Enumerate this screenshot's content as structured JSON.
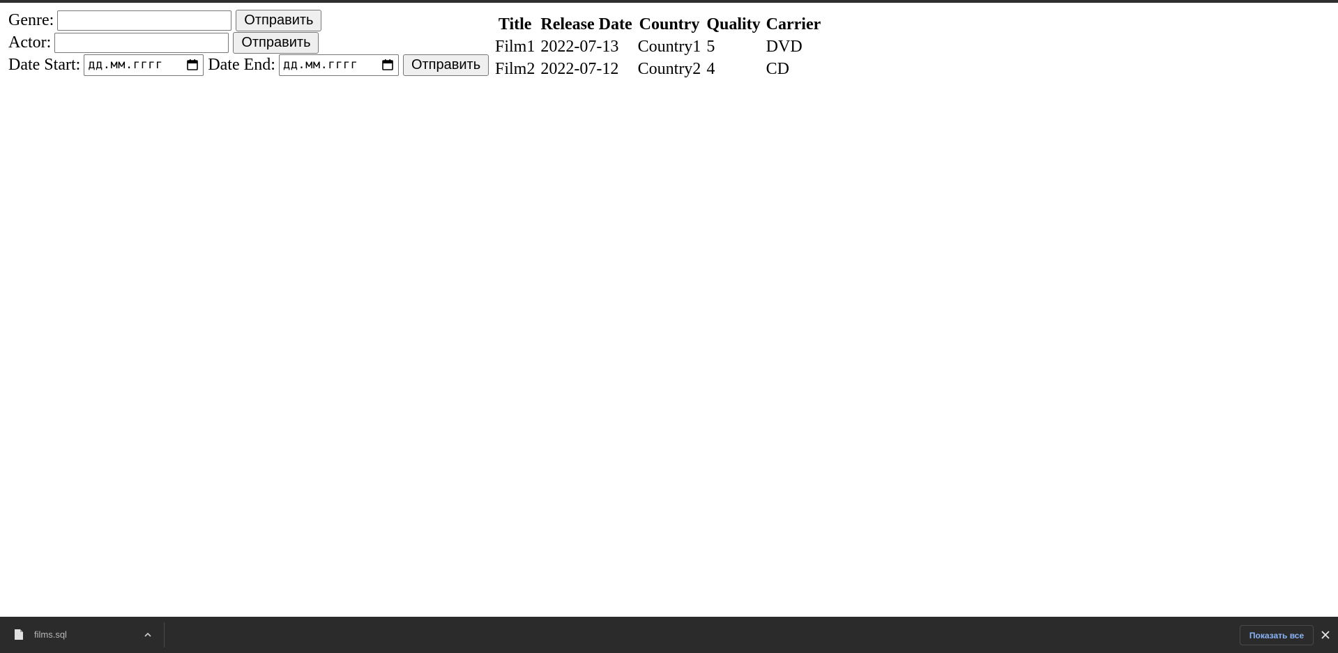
{
  "forms": {
    "genre": {
      "label": "Genre:",
      "value": "",
      "submit_label": "Отправить"
    },
    "actor": {
      "label": "Actor:",
      "value": "",
      "submit_label": "Отправить"
    },
    "dates": {
      "start_label": "Date Start:",
      "start_placeholder": "дд.мм.гггг",
      "end_label": "Date End:",
      "end_placeholder": "дд.мм.гггг",
      "submit_label": "Отправить"
    }
  },
  "results": {
    "headers": {
      "title": "Title",
      "release_date": "Release Date",
      "country": "Country",
      "quality": "Quality",
      "carrier": "Carrier"
    },
    "rows": [
      {
        "title": "Film1",
        "release_date": "2022-07-13",
        "country": "Country1",
        "quality": "5",
        "carrier": "DVD"
      },
      {
        "title": "Film2",
        "release_date": "2022-07-12",
        "country": "Country2",
        "quality": "4",
        "carrier": "CD"
      }
    ]
  },
  "download_bar": {
    "file_name": "films.sql",
    "file_icon": "file-icon",
    "menu_icon": "chevron-up-icon",
    "show_all_label": "Показать все",
    "close_icon": "close-icon",
    "background_color": "#2b2b2b",
    "link_color": "#8ab4f8"
  }
}
